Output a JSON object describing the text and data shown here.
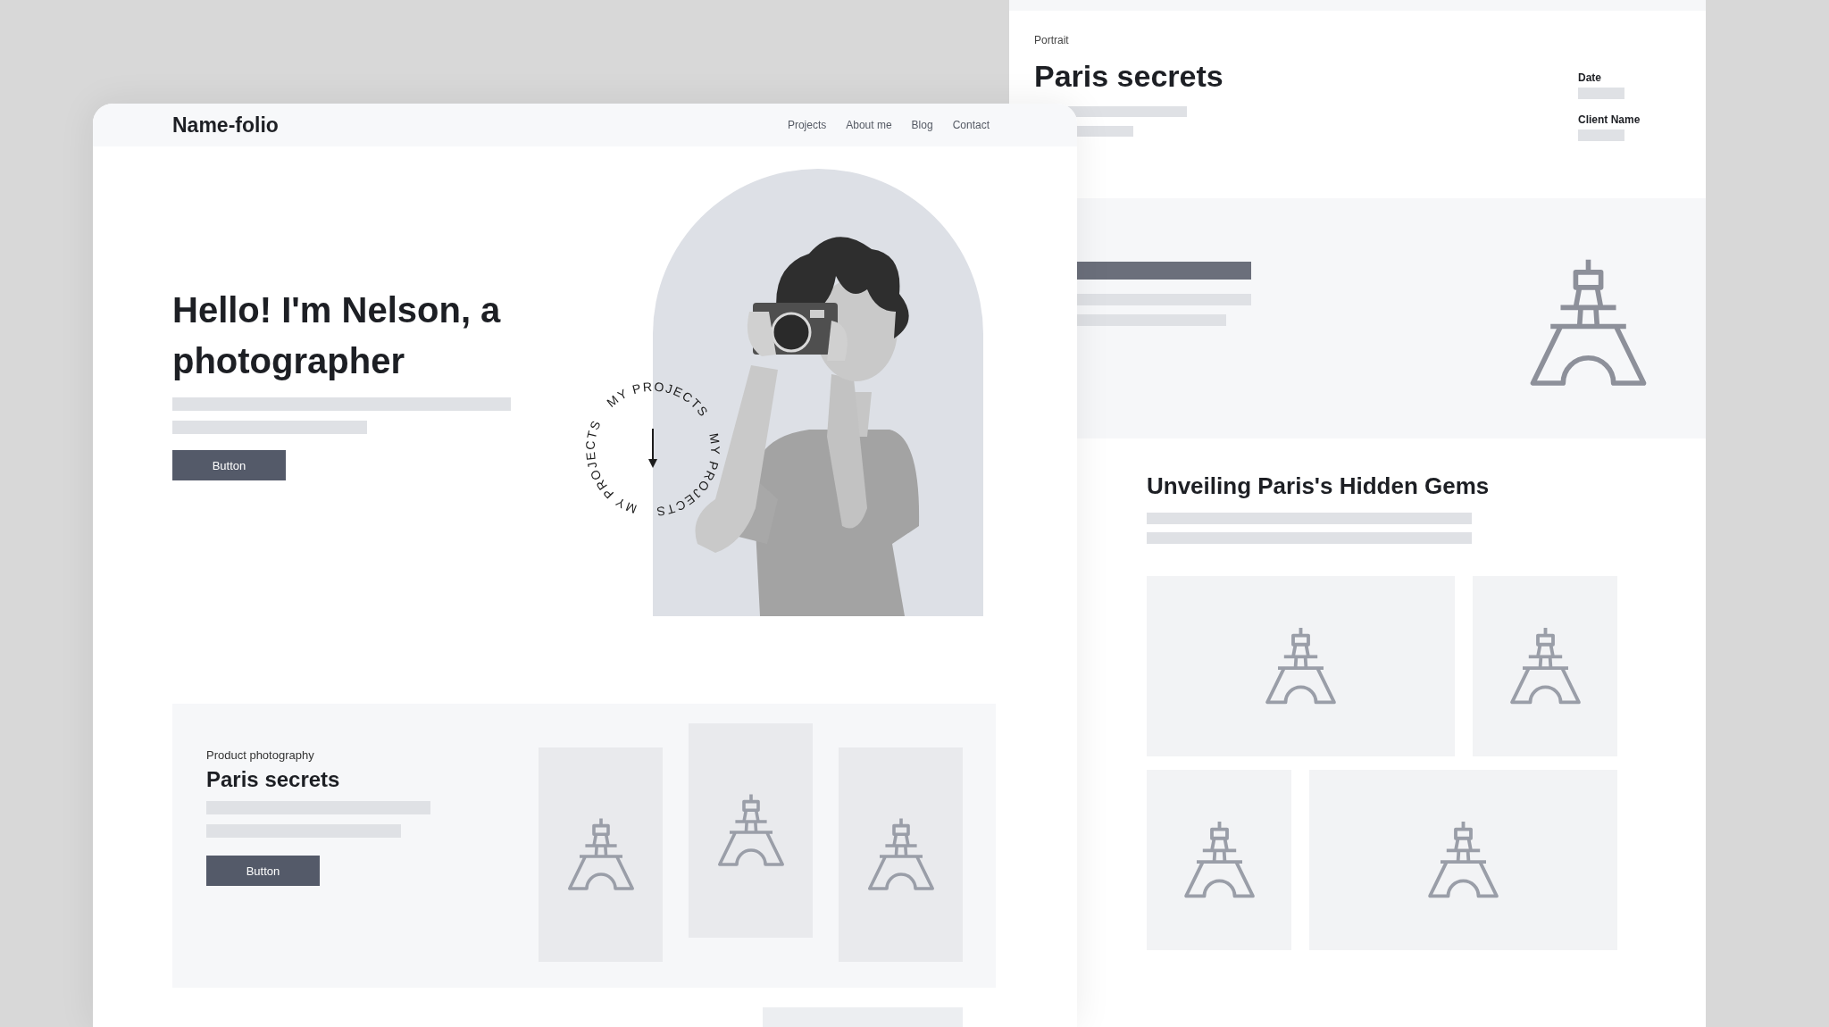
{
  "front_page": {
    "logo": "Name-folio",
    "nav": [
      {
        "label": "Projects"
      },
      {
        "label": "About me"
      },
      {
        "label": "Blog"
      },
      {
        "label": "Contact"
      }
    ],
    "hero": {
      "title": "Hello! I'm Nelson, a photographer",
      "button": "Button",
      "circle_labels": [
        "MY PROJECTS",
        "MY PROJECTS",
        "MY PROJECTS"
      ]
    },
    "project": {
      "category": "Product photography",
      "title": "Paris secrets",
      "button": "Button"
    }
  },
  "back_page": {
    "category": "Portrait",
    "title": "Paris secrets",
    "meta": [
      {
        "label": "Date"
      },
      {
        "label": "Client Name"
      }
    ],
    "section_title": "Unveiling Paris's Hidden Gems"
  }
}
